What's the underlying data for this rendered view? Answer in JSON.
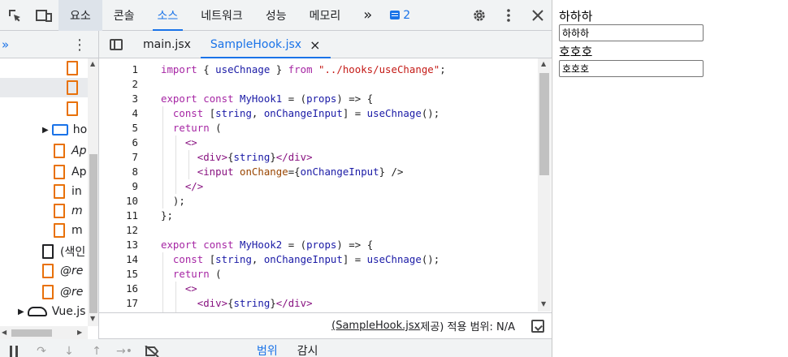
{
  "toolbar": {
    "tabs": [
      "요소",
      "콘솔",
      "소스",
      "네트워크",
      "성능",
      "메모리"
    ],
    "more": "»",
    "issue_count": "2",
    "inspect_icon": "inspect-element-icon",
    "device_icon": "device-toggle-icon"
  },
  "subbar": {
    "nav_more": "»",
    "nav_menu": "⋮",
    "file_tabs": [
      "main.jsx",
      "SampleHook.jsx"
    ],
    "close": "×"
  },
  "navigator": {
    "items": [
      {
        "label": ""
      },
      {
        "label": ""
      },
      {
        "label": ""
      },
      {
        "label": "ho"
      },
      {
        "label": "Ap"
      },
      {
        "label": "Ap"
      },
      {
        "label": "in"
      },
      {
        "label": "m"
      },
      {
        "label": "m"
      },
      {
        "label": "(색인"
      },
      {
        "label": "@re"
      },
      {
        "label": "@re"
      },
      {
        "label": "Vue.js"
      }
    ]
  },
  "editor": {
    "line_numbers": [
      "1",
      "2",
      "3",
      "4",
      "5",
      "6",
      "7",
      "8",
      "9",
      "10",
      "11",
      "12",
      "13",
      "14",
      "15",
      "16",
      "17"
    ],
    "lines": [
      "import { useChnage } from \"../hooks/useChange\";",
      "",
      "export const MyHook1 = (props) => {",
      "  const [string, onChangeInput] = useChnage();",
      "  return (",
      "    <>",
      "      <div>{string}</div>",
      "      <input onChange={onChangeInput} />",
      "    </>",
      "  );",
      "};",
      "",
      "export const MyHook2 = (props) => {",
      "  const [string, onChangeInput] = useChnage();",
      "  return (",
      "    <>",
      "      <div>{string}</div>"
    ]
  },
  "status": {
    "source_link": "(SampleHook.jsx",
    "rest": " 제공) 적용 범위: N/A"
  },
  "debug": {
    "tabs": [
      "범위",
      "감시"
    ]
  },
  "preview": {
    "label1": "하하하",
    "input1": "하하하",
    "label2": "호호호",
    "input2": "호호호"
  },
  "colors": {
    "accent": "#1a73e8",
    "file_icon": "#e8710a",
    "keyword": "#a626a4",
    "string": "#c41a16"
  }
}
